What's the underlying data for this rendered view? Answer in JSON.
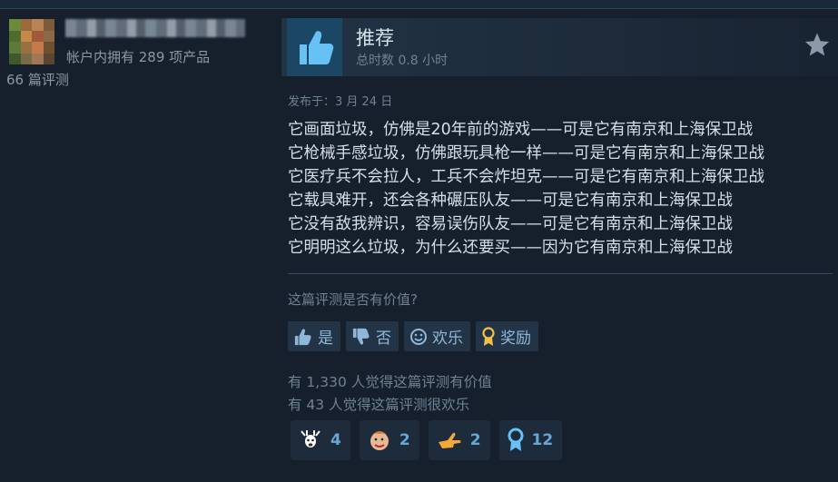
{
  "user": {
    "owned_text": "帐户内拥有 289 项产品",
    "review_count_text": "66 篇评测"
  },
  "review": {
    "verdict": "推荐",
    "hours": "总时数 0.8 小时",
    "posted": "发布于：3 月 24 日",
    "lines": [
      "它画面垃圾，仿佛是20年前的游戏——可是它有南京和上海保卫战",
      "它枪械手感垃圾，仿佛跟玩具枪一样——可是它有南京和上海保卫战",
      "它医疗兵不会拉人，工兵不会炸坦克——可是它有南京和上海保卫战",
      "它载具难开，还会各种碾压队友——可是它有南京和上海保卫战",
      "它没有敌我辨识，容易误伤队友——可是它有南京和上海保卫战",
      "它明明这么垃圾，为什么还要买——因为它有南京和上海保卫战"
    ]
  },
  "feedback": {
    "question": "这篇评测是否有价值?",
    "buttons": {
      "yes": "是",
      "no": "否",
      "funny": "欢乐",
      "award": "奖励"
    },
    "helpful_text": "有 1,330 人觉得这篇评测有价值",
    "funny_text": "有 43 人觉得这篇评测很欢乐"
  },
  "awards": [
    {
      "icon": "deer-award-icon",
      "count": "4"
    },
    {
      "icon": "clown-award-icon",
      "count": "2"
    },
    {
      "icon": "pointing-hand-award-icon",
      "count": "2"
    },
    {
      "icon": "ribbon-award-icon",
      "count": "12"
    }
  ],
  "colors": {
    "background": "#16202d",
    "accent": "#67a8d6",
    "muted": "#6f8293"
  }
}
